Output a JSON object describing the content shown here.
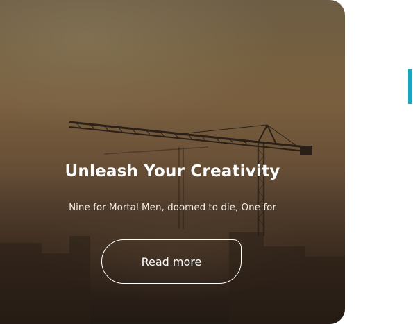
{
  "card": {
    "title": "Unleash Your Creativity",
    "text": "Nine for Mortal Men, doomed to die, One for",
    "button_label": "Read more"
  },
  "colors": {
    "accent_tab": "#1aa6c0",
    "card_text": "#ffffff",
    "page_background": "#ffffff"
  },
  "icons": {
    "background": "construction-crane-silhouette"
  }
}
